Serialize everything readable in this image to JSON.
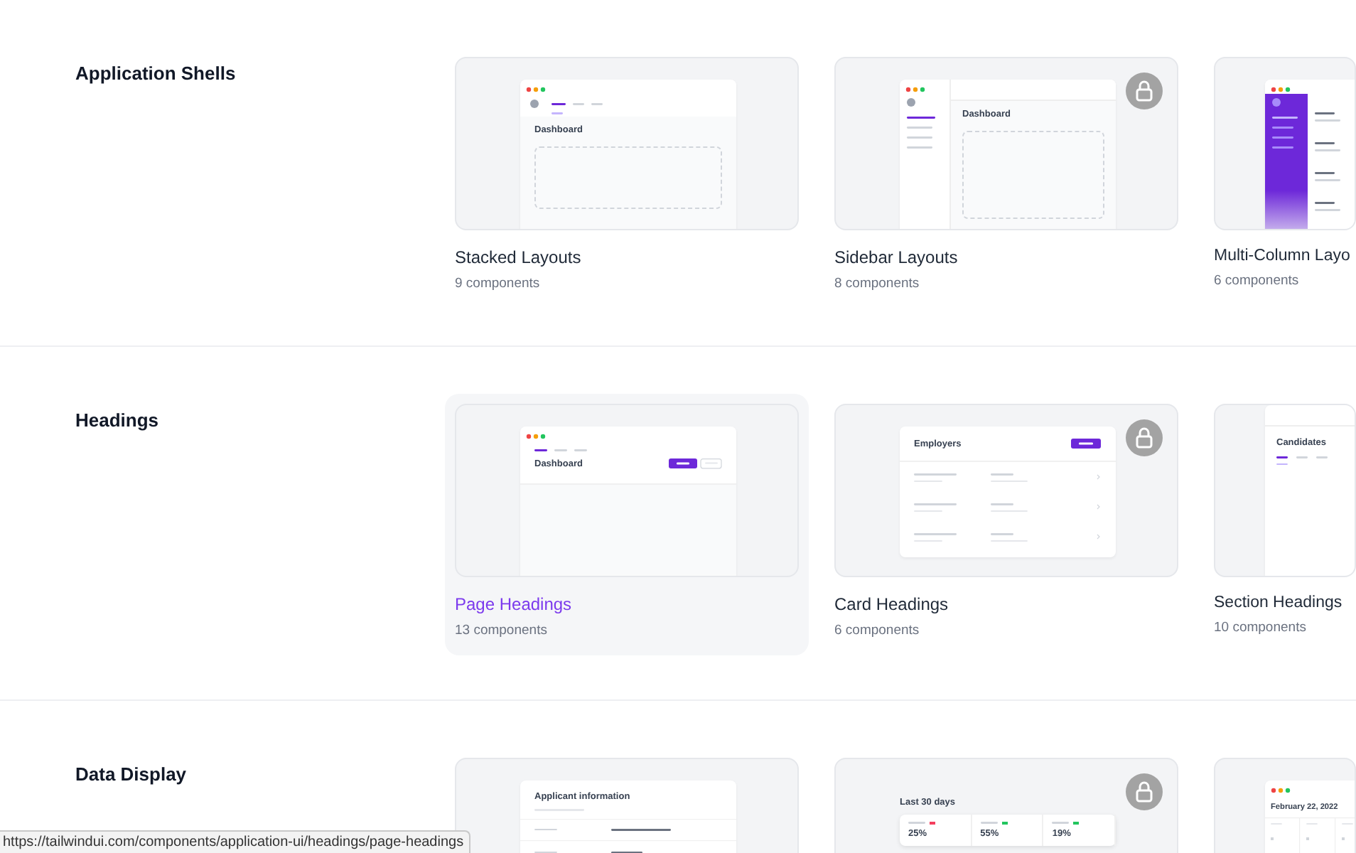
{
  "sections": [
    {
      "title": "Application Shells",
      "cards": [
        {
          "title": "Stacked Layouts",
          "count": "9 components",
          "selected": false,
          "locked": false,
          "preview": {
            "kind": "stacked",
            "heading": "Dashboard"
          }
        },
        {
          "title": "Sidebar Layouts",
          "count": "8 components",
          "selected": false,
          "locked": true,
          "preview": {
            "kind": "sidebar",
            "heading": "Dashboard"
          }
        },
        {
          "title": "Multi-Column Layo",
          "count": "6 components",
          "selected": false,
          "locked": false,
          "preview": {
            "kind": "multicolumn"
          }
        }
      ]
    },
    {
      "title": "Headings",
      "cards": [
        {
          "title": "Page Headings",
          "count": "13 components",
          "selected": true,
          "locked": false,
          "preview": {
            "kind": "pageheading",
            "heading": "Dashboard"
          }
        },
        {
          "title": "Card Headings",
          "count": "6 components",
          "selected": false,
          "locked": true,
          "preview": {
            "kind": "cardheading",
            "heading": "Employers"
          }
        },
        {
          "title": "Section Headings",
          "count": "10 components",
          "selected": false,
          "locked": false,
          "preview": {
            "kind": "sectionheading",
            "heading": "Candidates"
          }
        }
      ]
    },
    {
      "title": "Data Display",
      "cards": [
        {
          "selected": false,
          "locked": false,
          "preview": {
            "kind": "description",
            "heading": "Applicant information"
          }
        },
        {
          "selected": false,
          "locked": true,
          "preview": {
            "kind": "stats",
            "heading": "Last 30 days",
            "stats": [
              {
                "value": "25%",
                "color": "#f43f5e"
              },
              {
                "value": "55%",
                "color": "#22c55e"
              },
              {
                "value": "19%",
                "color": "#22c55e"
              }
            ]
          }
        },
        {
          "selected": false,
          "locked": false,
          "preview": {
            "kind": "calendar",
            "heading": "February 22, 2022"
          }
        }
      ]
    }
  ],
  "status_url": "https://tailwindui.com/components/application-ui/headings/page-headings"
}
